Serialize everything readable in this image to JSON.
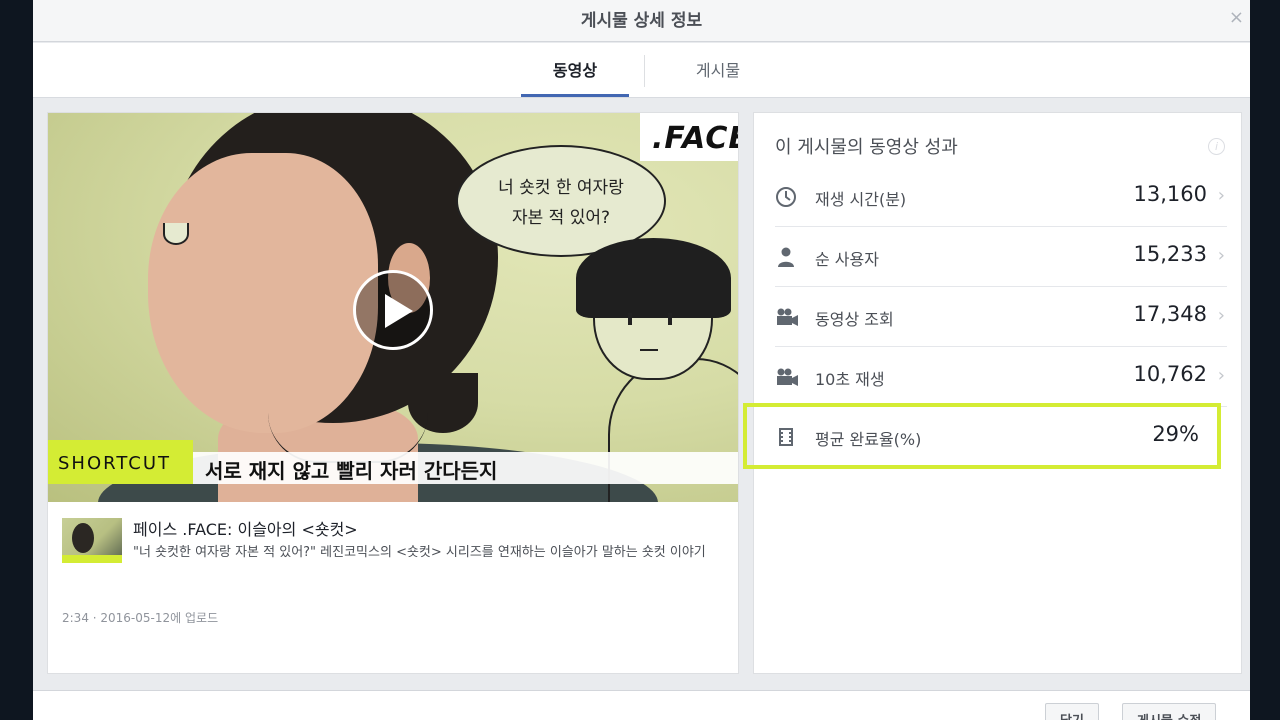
{
  "modal": {
    "title": "게시물 상세 정보",
    "close_glyph": "×"
  },
  "tabs": [
    {
      "label": "동영상",
      "active": true
    },
    {
      "label": "게시물",
      "active": false
    }
  ],
  "video": {
    "speech_bubble": "너 숏컷 한 여자랑\n자본 적 있어?",
    "logo": ".FACE",
    "caption_tag": "SHORTCUT",
    "caption_text": "서로 재지 않고 빨리 자러 간다든지"
  },
  "post": {
    "title": "페이스 .FACE: 이슬아의 <숏컷>",
    "description": "\"너 숏컷한 여자랑 자본 적 있어?\" 레진코믹스의 <숏컷> 시리즈를 연재하는 이슬아가 말하는 숏컷 이야기",
    "meta": "2:34  ·  2016-05-12에 업로드"
  },
  "performance": {
    "title": "이 게시물의 동영상 성과",
    "info_glyph": "i",
    "chevron_glyph": "›",
    "metrics": [
      {
        "icon": "clock-icon",
        "label": "재생 시간(분)",
        "value": "13,160"
      },
      {
        "icon": "person-icon",
        "label": "순 사용자",
        "value": "15,233"
      },
      {
        "icon": "video-camera-icon",
        "label": "동영상 조회",
        "value": "17,348"
      },
      {
        "icon": "video-camera-icon",
        "label": "10초 재생",
        "value": "10,762"
      },
      {
        "icon": "film-icon",
        "label": "평균 완료율(%)",
        "value": "29%"
      }
    ]
  },
  "footer": {
    "close_label": "닫기",
    "edit_label": "게시물 수정"
  },
  "colors": {
    "accent": "#4267b2",
    "highlight": "#d4ec34"
  }
}
